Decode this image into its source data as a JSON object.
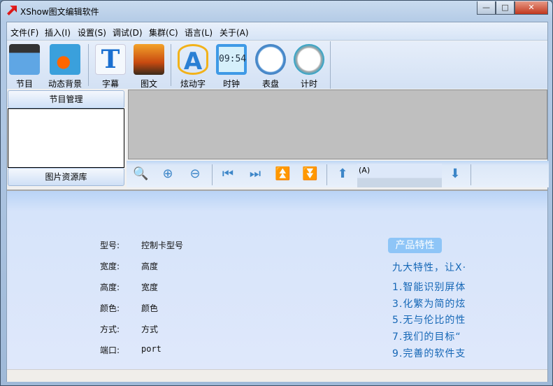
{
  "window": {
    "title": "XShow图文编辑软件",
    "minimize": "—",
    "maximize": "□",
    "close": "✕"
  },
  "menu": [
    "文件(F)",
    "插入(I)",
    "设置(S)",
    "调试(D)",
    "集群(C)",
    "语言(L)",
    "关于(A)"
  ],
  "toolbar": [
    {
      "label": "节目",
      "icon": "clapperboard-icon"
    },
    {
      "label": "动态背景",
      "icon": "clownfish-icon"
    },
    {
      "label": "字幕",
      "icon": "text-t-icon"
    },
    {
      "label": "图文",
      "icon": "photo-icon"
    },
    {
      "label": "炫动字",
      "icon": "magic-text-icon"
    },
    {
      "label": "时钟",
      "icon": "digital-clock-icon",
      "clock_text": "09:54"
    },
    {
      "label": "表盘",
      "icon": "analog-clock-icon"
    },
    {
      "label": "计时",
      "icon": "timer-icon"
    }
  ],
  "left_panel": {
    "program_manage": "节目管理",
    "image_library": "图片资源库"
  },
  "controls": {
    "tooltip": "(A)",
    "glyphs": {
      "zoom": "🔍",
      "zoom_in": "⊕",
      "zoom_out": "⊖",
      "first": "⏮",
      "last": "⏭",
      "top": "⏫",
      "bottom": "⏬",
      "up": "⬆",
      "down": "⬇"
    }
  },
  "form": [
    {
      "label": "型号:",
      "value": "控制卡型号"
    },
    {
      "label": "宽度:",
      "value": "高度"
    },
    {
      "label": "高度:",
      "value": "宽度"
    },
    {
      "label": "颜色:",
      "value": "颜色"
    },
    {
      "label": "方式:",
      "value": "方式"
    },
    {
      "label": "端口:",
      "value": "port"
    }
  ],
  "features": {
    "badge": "产品特性",
    "lines": [
      "九大特性，让X·",
      "1.智能识别屏体",
      "3.化繁为简的炫",
      "5.无与伦比的性",
      "7.我们的目标“",
      "9.完善的软件支"
    ]
  },
  "colors": {
    "accent": "#1567b6",
    "badge": "#8ec5f7"
  }
}
